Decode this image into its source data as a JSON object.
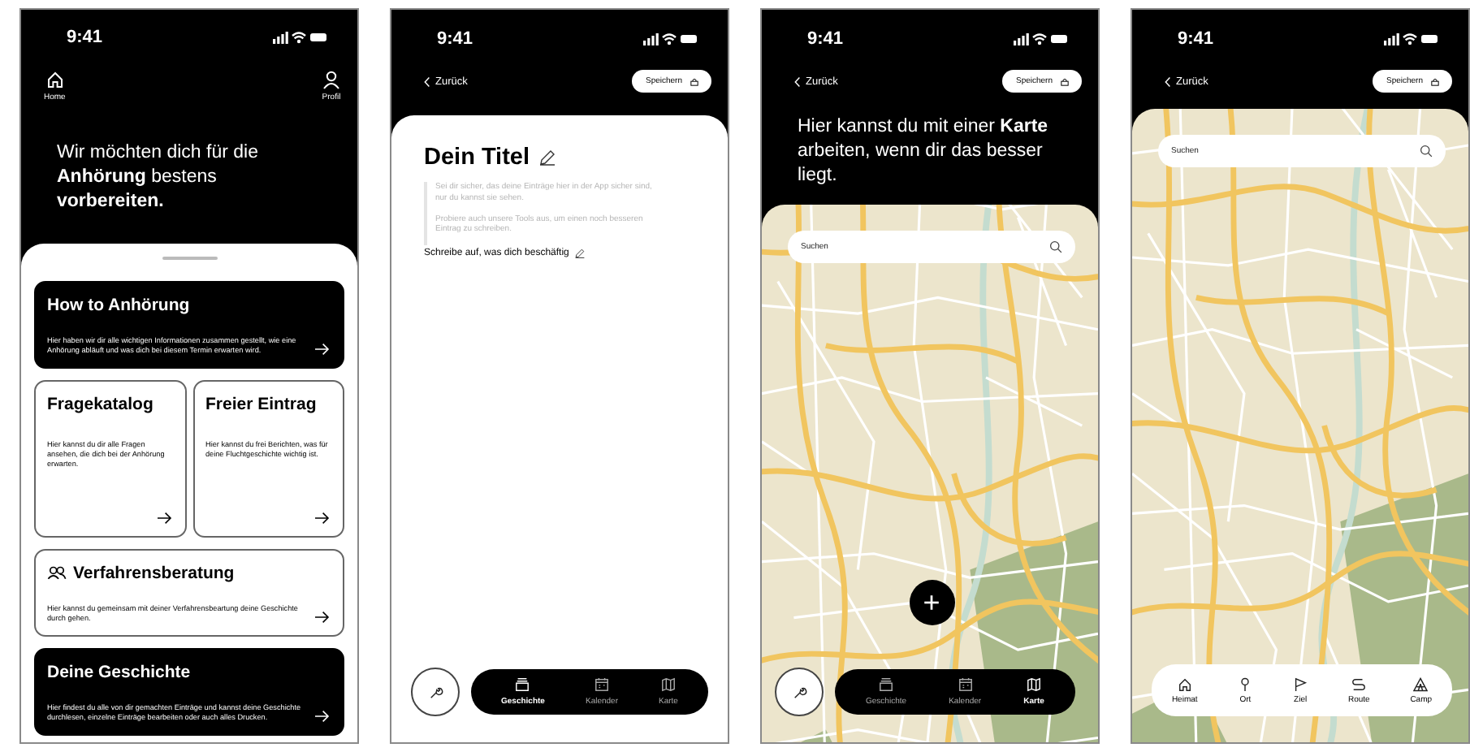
{
  "screens": [
    {
      "kind": "home",
      "time": "9:41",
      "nav": [
        {
          "label": "Home"
        },
        {
          "label": "Profil"
        }
      ],
      "headline": "Wir möchten dich für die **Anhörung** bestens **vorbereiten.**",
      "card_rows": [
        [
          {
            "title": "How to Anhörung",
            "text": "Hier haben wir dir alle wichtigen Informationen zusammen gestellt, wie eine Anhörung abläuft und was dich bei diesem Termin erwarten wird.",
            "dark": true
          }
        ],
        [
          {
            "title": "Fragekatalog",
            "text": "Hier kannst du dir alle Fragen ansehen, die dich bei der Anhörung erwarten.",
            "dark": false
          },
          {
            "title": "Freier Eintrag",
            "text": "Hier kannst du frei Berichten, was für deine Fluchtgeschichte wichtig ist.",
            "dark": false
          }
        ],
        [
          {
            "title": "Verfahrensberatung",
            "text": "Hier kannst du gemeinsam mit deiner Verfahrensbeartung deine Geschichte durch gehen.",
            "dark": false
          }
        ],
        [
          {
            "title": "Deine Geschichte",
            "text": "Hier findest du alle von dir gemachten Einträge und kannst deine Geschichte durchlesen, einzelne Einträge bearbeiten oder auch alles Drucken.",
            "dark": true
          }
        ]
      ]
    },
    {
      "kind": "editor",
      "time": "9:41",
      "back": "Zurück",
      "save": "Speichern",
      "title": "Dein Titel",
      "hints": [
        "Sei dir sicher, das deine Einträge hier in der App sicher sind, nur du kannst sie sehen.",
        "Probiere auch unsere Tools aus, um einen noch besseren Eintrag zu schreiben."
      ],
      "prompt": "Schreibe auf, was dich beschäftig",
      "tabs": [
        {
          "label": "Geschichte",
          "selected": true
        },
        {
          "label": "Kalender",
          "selected": false
        },
        {
          "label": "Karte",
          "selected": false
        }
      ]
    },
    {
      "kind": "map_intro",
      "time": "9:41",
      "back": "Zurück",
      "save": "Speichern",
      "headline": "Hier kannst du mit einer **Karte** arbeiten, wenn dir das besser liegt.",
      "search": {
        "placeholder": "Suchen"
      },
      "add": "+",
      "tabs": [
        {
          "label": "Geschichte",
          "selected": false
        },
        {
          "label": "Kalender",
          "selected": false
        },
        {
          "label": "Karte",
          "selected": true
        }
      ]
    },
    {
      "kind": "map",
      "time": "9:41",
      "back": "Zurück",
      "save": "Speichern",
      "search": {
        "placeholder": "Suchen"
      },
      "tools": [
        {
          "label": "Heimat"
        },
        {
          "label": "Ort"
        },
        {
          "label": "Ziel"
        },
        {
          "label": "Route"
        },
        {
          "label": "Camp"
        }
      ]
    }
  ]
}
